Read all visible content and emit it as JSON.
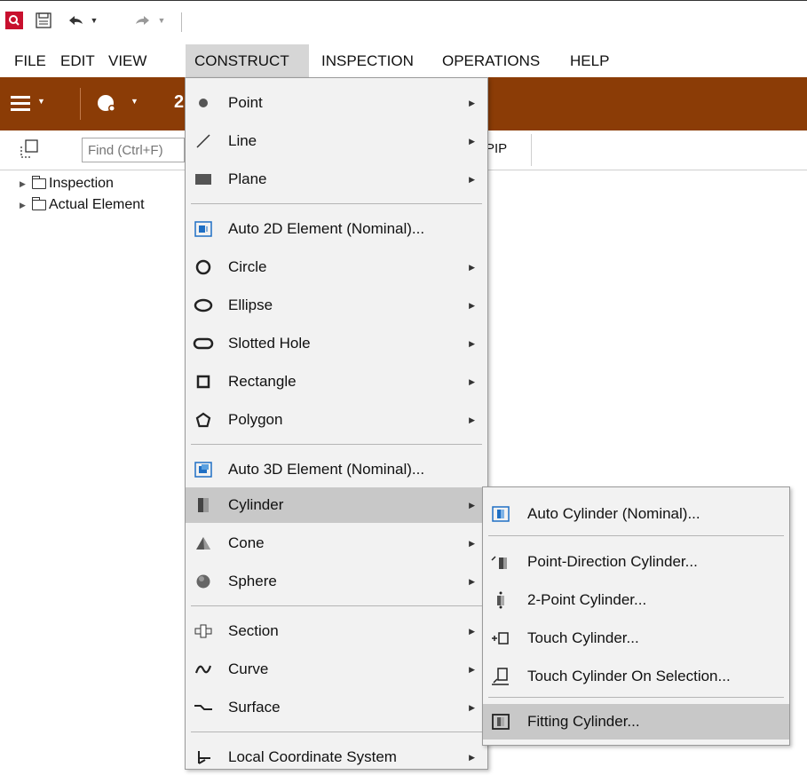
{
  "menubar": {
    "items": [
      "FILE",
      "EDIT",
      "VIEW",
      "CONSTRUCT",
      "INSPECTION",
      "OPERATIONS",
      "HELP"
    ],
    "active": "CONSTRUCT"
  },
  "search": {
    "placeholder": "Find (Ctrl+F)"
  },
  "toolbar_partial_label": "PIP",
  "tree": {
    "items": [
      "Inspection",
      "Actual Element"
    ]
  },
  "construct_menu": {
    "items": [
      {
        "label": "Point",
        "icon": "point-icon",
        "submenu": true
      },
      {
        "label": "Line",
        "icon": "line-icon",
        "submenu": true
      },
      {
        "label": "Plane",
        "icon": "plane-icon",
        "submenu": true
      },
      {
        "label": "Auto 2D Element (Nominal)...",
        "icon": "auto-2d-element-icon",
        "submenu": false
      },
      {
        "label": "Circle",
        "icon": "circle-icon",
        "submenu": true
      },
      {
        "label": "Ellipse",
        "icon": "ellipse-icon",
        "submenu": true
      },
      {
        "label": "Slotted Hole",
        "icon": "slotted-hole-icon",
        "submenu": true
      },
      {
        "label": "Rectangle",
        "icon": "rectangle-icon",
        "submenu": true
      },
      {
        "label": "Polygon",
        "icon": "polygon-icon",
        "submenu": true
      },
      {
        "label": "Auto 3D Element (Nominal)...",
        "icon": "auto-3d-element-icon",
        "submenu": false
      },
      {
        "label": "Cylinder",
        "icon": "cylinder-icon",
        "submenu": true
      },
      {
        "label": "Cone",
        "icon": "cone-icon",
        "submenu": true
      },
      {
        "label": "Sphere",
        "icon": "sphere-icon",
        "submenu": true
      },
      {
        "label": "Section",
        "icon": "section-icon",
        "submenu": true
      },
      {
        "label": "Curve",
        "icon": "curve-icon",
        "submenu": true
      },
      {
        "label": "Surface",
        "icon": "surface-icon",
        "submenu": true
      },
      {
        "label": "Local Coordinate System",
        "icon": "local-coordinate-system-icon",
        "submenu": true
      }
    ],
    "highlighted": "Cylinder"
  },
  "cylinder_submenu": {
    "items": [
      {
        "label": "Auto Cylinder (Nominal)...",
        "icon": "auto-cylinder-icon"
      },
      {
        "label": "Point-Direction Cylinder...",
        "icon": "point-direction-cylinder-icon"
      },
      {
        "label": "2-Point Cylinder...",
        "icon": "two-point-cylinder-icon"
      },
      {
        "label": "Touch Cylinder...",
        "icon": "touch-cylinder-icon"
      },
      {
        "label": "Touch Cylinder On Selection...",
        "icon": "touch-cylinder-on-selection-icon"
      },
      {
        "label": "Fitting Cylinder...",
        "icon": "fitting-cylinder-icon"
      }
    ],
    "highlighted": "Fitting Cylinder..."
  },
  "colors": {
    "ribbon": "#8b3c06",
    "menu_bg": "#f2f2f2",
    "highlight": "#c8c8c8",
    "logo": "#c8102e",
    "icon_blue": "#1f6fc4"
  }
}
